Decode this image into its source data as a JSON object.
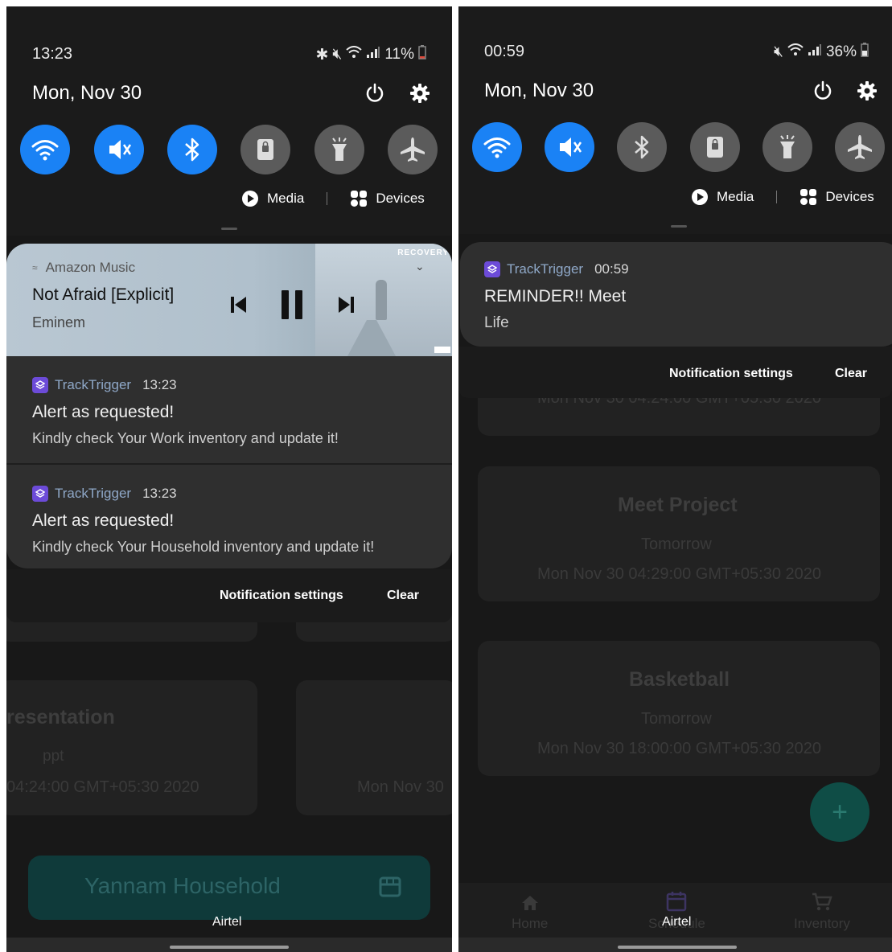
{
  "left": {
    "status": {
      "time": "13:23",
      "battery": "11%"
    },
    "date": "Mon, Nov 30",
    "quick_settings": [
      {
        "name": "wifi",
        "on": true
      },
      {
        "name": "mute",
        "on": true
      },
      {
        "name": "bluetooth",
        "on": true
      },
      {
        "name": "lock",
        "on": false
      },
      {
        "name": "flashlight",
        "on": false
      },
      {
        "name": "airplane",
        "on": false
      }
    ],
    "media_label": "Media",
    "devices_label": "Devices",
    "music": {
      "app": "Amazon Music",
      "title": "Not Afraid [Explicit]",
      "artist": "Eminem",
      "album_logo": "RECOVERY"
    },
    "notifications": [
      {
        "app": "TrackTrigger",
        "time": "13:23",
        "title": "Alert as requested!",
        "body": "Kindly check Your Work inventory and update it!"
      },
      {
        "app": "TrackTrigger",
        "time": "13:23",
        "title": "Alert as requested!",
        "body": "Kindly check Your Household inventory and update it!"
      }
    ],
    "notification_settings": "Notification settings",
    "clear": "Clear",
    "background": {
      "card_title": "resentation",
      "card_sub": "ppt",
      "card_date": "04:24:00 GMT+05:30 2020",
      "card2_date": "Mon Nov 30",
      "household_button": "Yannam Household"
    },
    "carrier": "Airtel"
  },
  "right": {
    "status": {
      "time": "00:59",
      "battery": "36%"
    },
    "date": "Mon, Nov 30",
    "quick_settings": [
      {
        "name": "wifi",
        "on": true
      },
      {
        "name": "mute",
        "on": true
      },
      {
        "name": "bluetooth",
        "on": false
      },
      {
        "name": "lock",
        "on": false
      },
      {
        "name": "flashlight",
        "on": false
      },
      {
        "name": "airplane",
        "on": false
      }
    ],
    "media_label": "Media",
    "devices_label": "Devices",
    "notifications": [
      {
        "app": "TrackTrigger",
        "time": "00:59",
        "title": "REMINDER!! Meet",
        "body": "Life"
      }
    ],
    "notification_settings": "Notification settings",
    "clear": "Clear",
    "background": {
      "partial_date": "Mon Nov 30 04:24:00 GMT+05:30 2020",
      "cards": [
        {
          "title": "Meet Project",
          "when": "Tomorrow",
          "date": "Mon Nov 30 04:29:00 GMT+05:30 2020"
        },
        {
          "title": "Basketball",
          "when": "Tomorrow",
          "date": "Mon Nov 30 18:00:00 GMT+05:30 2020"
        }
      ],
      "nav": [
        "Home",
        "Schedule",
        "Inventory"
      ]
    },
    "carrier": "Airtel"
  },
  "colors": {
    "accent": "#1a82f5",
    "tile_off": "#5b5b5b",
    "app_icon": "#6c4bd8",
    "fab": "#0f6d60"
  }
}
